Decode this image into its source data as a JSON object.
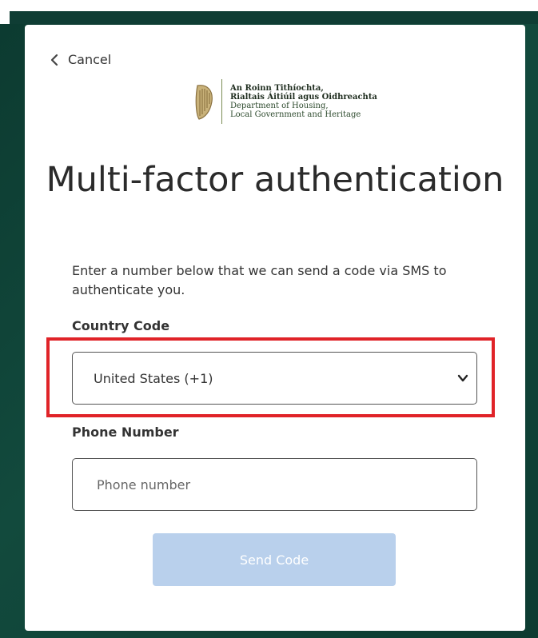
{
  "nav": {
    "cancel_label": "Cancel"
  },
  "logo": {
    "line1": "An Roinn Tithíochta,",
    "line2": "Rialtais Áitiúil agus Oidhreachta",
    "line3": "Department of Housing,",
    "line4": "Local Government and Heritage"
  },
  "page": {
    "title": "Multi-factor authentication",
    "description": "Enter a number below that we can send a code via SMS to authenticate you."
  },
  "form": {
    "country_label": "Country Code",
    "country_value": "United States (+1)",
    "phone_label": "Phone Number",
    "phone_placeholder": "Phone number",
    "phone_value": "",
    "send_label": "Send Code"
  },
  "colors": {
    "background": "#0f3d34",
    "highlight": "#e02328",
    "button_disabled": "#b9d0ec"
  },
  "icons": [
    "chevron-left-icon",
    "harp-icon",
    "chevron-down-icon"
  ]
}
